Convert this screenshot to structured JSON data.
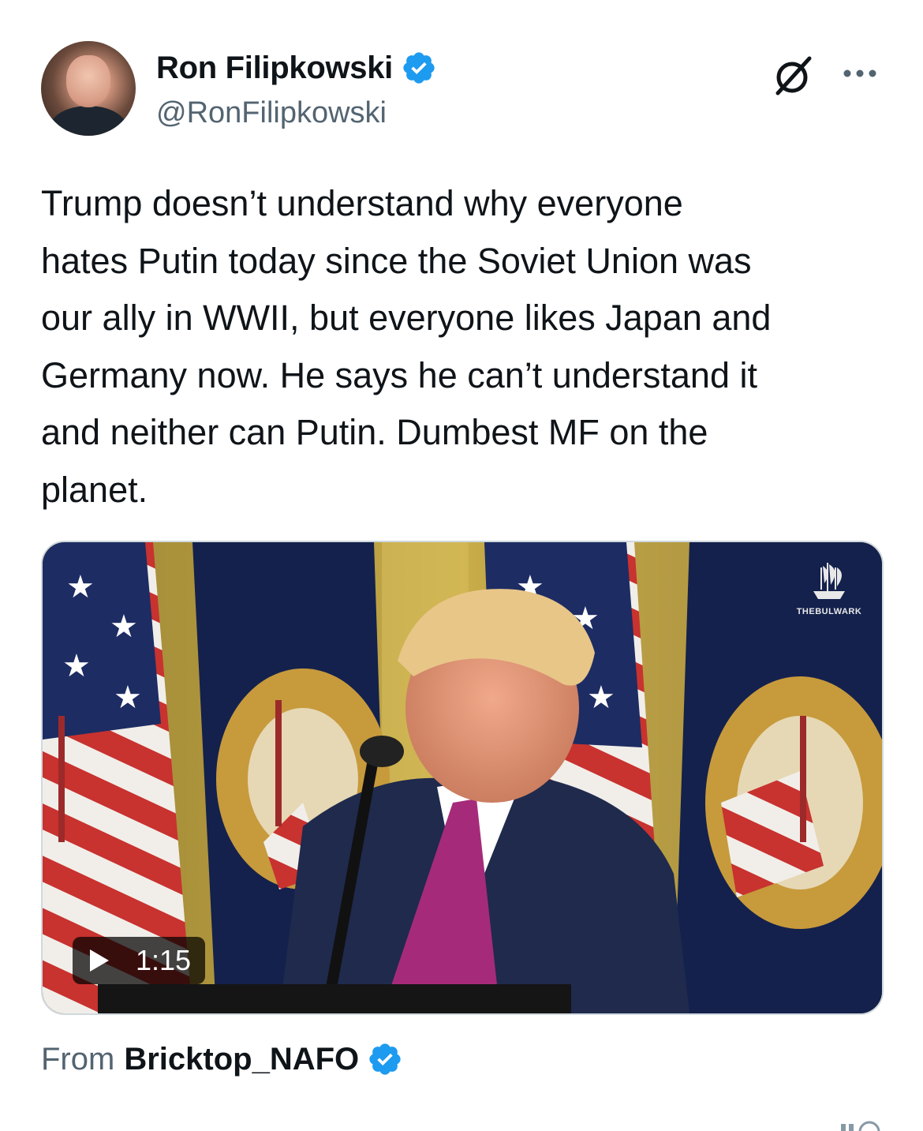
{
  "author": {
    "display_name": "Ron Filipkowski",
    "handle": "@RonFilipkowski",
    "verified": true
  },
  "header_actions": {
    "grok_icon": "grok-icon",
    "more_icon": "more-horizontal-icon"
  },
  "tweet": {
    "text": "Trump doesn’t understand why everyone\nhates Putin today since the Soviet Union was\nour ally in WWII, but everyone likes Japan and\nGermany now. He says he can’t understand it\nand neither can Putin. Dumbest MF on the\nplanet."
  },
  "media": {
    "type": "video",
    "duration": "1:15",
    "watermark": "THEBULWARK"
  },
  "source": {
    "from_label": "From",
    "name": "Bricktop_NAFO",
    "verified": true
  },
  "colors": {
    "verified_blue": "#1d9bf0",
    "text_primary": "#0f1419",
    "text_secondary": "#536471",
    "border": "#cfd9de"
  }
}
